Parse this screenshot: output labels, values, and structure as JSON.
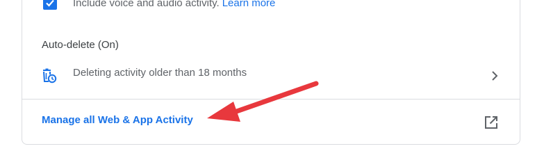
{
  "voice": {
    "text": "Include voice and audio activity.",
    "link": "Learn more",
    "checked": true
  },
  "autodelete": {
    "title": "Auto-delete (On)",
    "description": "Deleting activity older than 18 months",
    "icon": "auto-delete-icon"
  },
  "manage": {
    "label": "Manage all Web & App Activity",
    "icon": "open-in-new-icon"
  },
  "colors": {
    "accent": "#1a73e8",
    "annotation_arrow": "#e8383d",
    "text_secondary": "#5f6368",
    "divider": "#dadce0"
  }
}
